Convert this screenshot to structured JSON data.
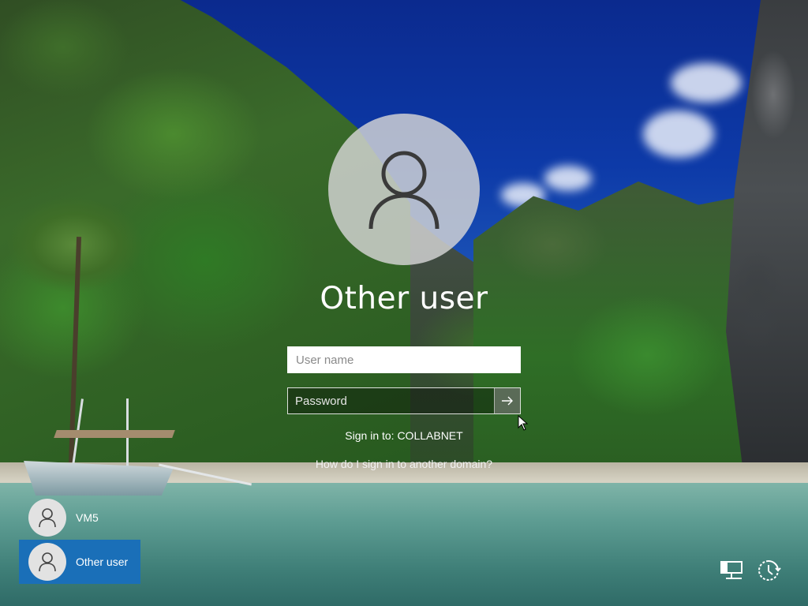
{
  "login": {
    "title": "Other user",
    "username_placeholder": "User name",
    "password_placeholder": "Password",
    "sign_in_to": "Sign in to: COLLABNET",
    "other_domain_link": "How do I sign in to another domain?"
  },
  "users": [
    {
      "name": "VM5",
      "selected": false
    },
    {
      "name": "Other user",
      "selected": true
    }
  ],
  "icons": {
    "avatar": "user-silhouette-icon",
    "submit": "arrow-right-icon",
    "network": "network-icon",
    "accessibility": "ease-of-access-icon"
  },
  "colors": {
    "selected_tile": "#1a6fb8",
    "avatar_bg": "#d6d6d6"
  }
}
